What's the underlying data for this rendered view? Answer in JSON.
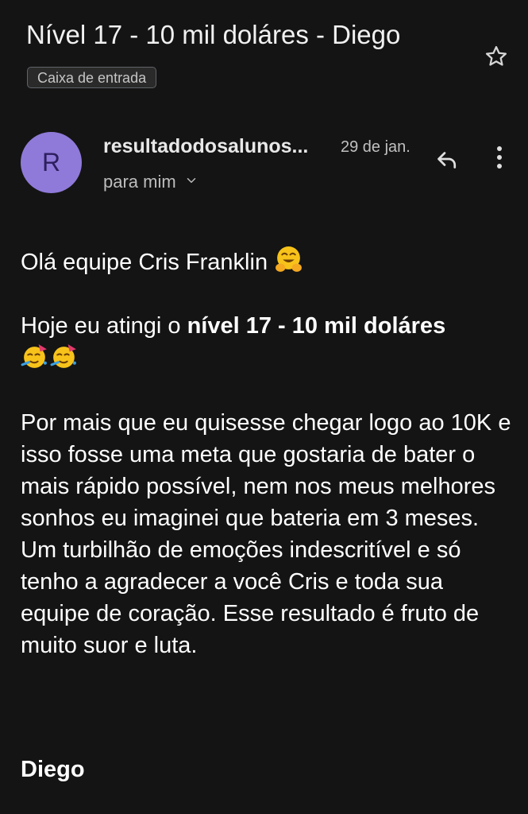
{
  "email": {
    "subject": "Nível 17 - 10 mil doláres - Diego",
    "label": "Caixa de entrada",
    "avatar_letter": "R",
    "sender": "resultadodosalunos...",
    "date": "29 de jan.",
    "recipient": "para mim"
  },
  "body": {
    "greeting": "Olá equipe Cris Franklin",
    "achievement_prefix": "Hoje eu atingi o ",
    "achievement_bold": "nível 17 - 10 mil doláres",
    "paragraph": "Por mais que eu quisesse chegar logo ao 10K e isso fosse uma meta que gostaria de bater o mais rápido possível, nem nos meus melhores sonhos eu imaginei que bateria em 3 meses. Um turbilhão de emoções indescritível e só tenho a agradecer a você Cris e toda sua equipe de coração. Esse resultado é fruto de muito suor e luta.",
    "signature": "Diego"
  },
  "icons": {
    "star": "star-outline-icon",
    "reply": "reply-icon",
    "more": "more-vert-icon",
    "chevron": "chevron-down-icon",
    "hugging": "hugging-face-emoji",
    "party": "partying-face-emoji"
  },
  "colors": {
    "background": "#141414",
    "avatar": "#8f7ad9",
    "text": "#ffffff",
    "secondary_text": "#bdbdbd"
  }
}
